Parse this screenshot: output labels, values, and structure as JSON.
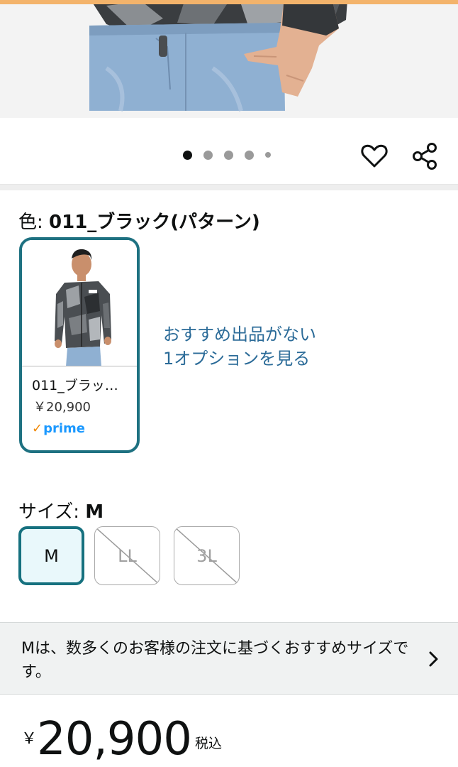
{
  "product": {
    "image_dots": {
      "count": 5,
      "active_index": 0
    },
    "icons": {
      "wishlist": "heart-icon",
      "share": "share-icon",
      "more": "chevron-right-icon"
    }
  },
  "color": {
    "label": "色: ",
    "selected_value": "011_ブラック(パターン)",
    "swatch": {
      "name": "011_ブラック(パターン)",
      "price": "￥20,900",
      "badge": "prime"
    },
    "more_options_link": [
      "おすすめ出品がない",
      "1オプションを見る"
    ]
  },
  "size": {
    "label": "サイズ: ",
    "selected_value": "M",
    "options": [
      {
        "label": "M",
        "available": true,
        "selected": true
      },
      {
        "label": "LL",
        "available": false,
        "selected": false
      },
      {
        "label": "3L",
        "available": false,
        "selected": false
      }
    ]
  },
  "size_recommendation": {
    "text": "Mは、数多くのお客様の注文に基づくおすすめサイズです。"
  },
  "price": {
    "symbol": "￥",
    "amount": "20,900",
    "tax_note": "税込"
  },
  "colors": {
    "accent_teal": "#16717f",
    "link_blue": "#2b6b98",
    "prime_blue": "#1a98ff",
    "prime_check": "#f08804"
  }
}
